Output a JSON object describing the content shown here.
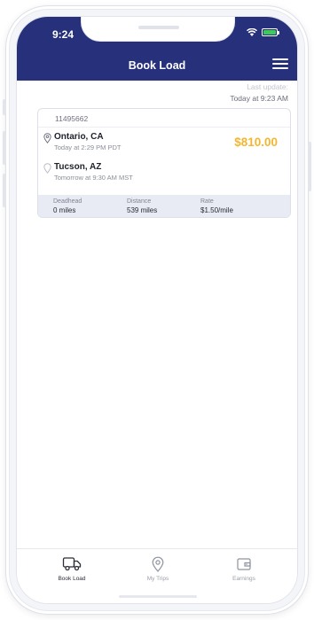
{
  "status_bar": {
    "time": "9:24"
  },
  "header": {
    "title": "Book Load",
    "menu_icon": "hamburger-menu-icon",
    "background": "#27307a"
  },
  "last_update": {
    "label": "Last update:",
    "value": "Today at 9:23 AM"
  },
  "load": {
    "id": "11495662",
    "price": "$810.00",
    "price_color": "#f2b632",
    "origin": {
      "city": "Ontario, CA",
      "time": "Today at 2:29 PM PDT",
      "icon": "map-pin-icon"
    },
    "destination": {
      "city": "Tucson, AZ",
      "time": "Tomorrow at 9:30 AM MST",
      "icon": "map-pin-icon"
    },
    "stats": [
      {
        "label": "Deadhead",
        "value": "0 miles"
      },
      {
        "label": "Distance",
        "value": "539 miles"
      },
      {
        "label": "Rate",
        "value": "$1.50/mile"
      }
    ]
  },
  "tabs": [
    {
      "label": "Book Load",
      "icon": "truck-icon",
      "active": true
    },
    {
      "label": "My Trips",
      "icon": "location-pin-icon",
      "active": false
    },
    {
      "label": "Earnings",
      "icon": "wallet-icon",
      "active": false
    }
  ]
}
